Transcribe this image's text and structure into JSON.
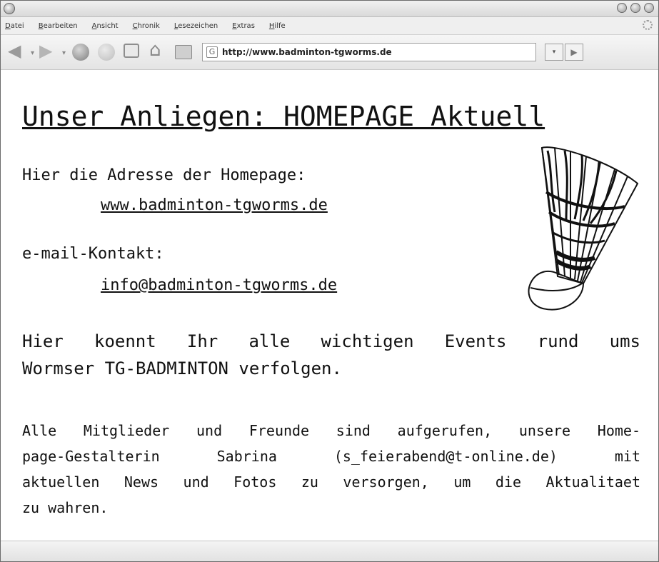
{
  "browser": {
    "menu": [
      "Datei",
      "Bearbeiten",
      "Ansicht",
      "Chronik",
      "Lesezeichen",
      "Extras",
      "Hilfe"
    ],
    "url": "http://www.badminton-tgworms.de",
    "favicon_glyph": "G"
  },
  "page": {
    "title": "Unser Anliegen: HOMEPAGE Aktuell",
    "address_label": "Hier die Adresse der Homepage:",
    "address_link": "www.badminton-tgworms.de",
    "email_label": "e-mail-Kontakt:",
    "email_link": "info@badminton-tgworms.de",
    "events_line1": "Hier koennt Ihr alle wichtigen Events rund ums",
    "events_line2": "Wormser TG-BADMINTON verfolgen.",
    "members_line1": "Alle Mitglieder und Freunde sind aufgerufen, unsere Home-",
    "members_line2": "page-Gestalterin Sabrina (s_feierabend@t-online.de) mit",
    "members_line3": "aktuellen News und Fotos zu versorgen, um die Aktualitaet",
    "members_line4": "zu wahren."
  },
  "icons": {
    "back": "back-arrow-icon",
    "forward": "forward-arrow-icon",
    "reload": "reload-icon",
    "stop": "stop-icon",
    "new_tab": "new-tab-icon",
    "home": "home-icon",
    "print": "print-icon",
    "go": "go-arrow-icon",
    "illustration": "shuttlecock-icon"
  }
}
